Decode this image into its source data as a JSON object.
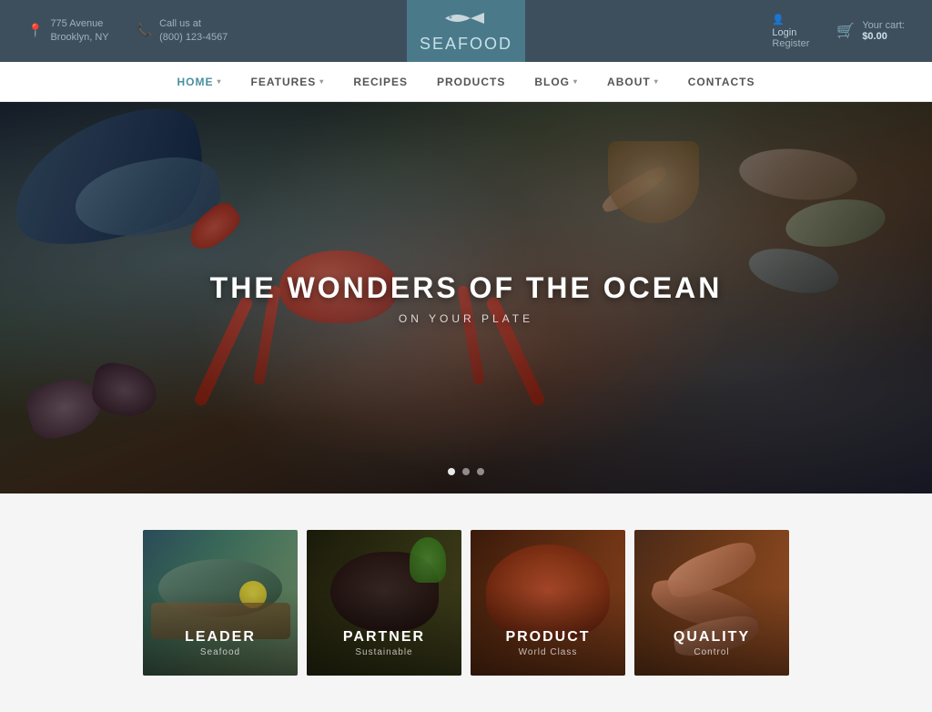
{
  "topbar": {
    "address_line1": "775 Avenue",
    "address_line2": "Brooklyn, NY",
    "phone_label": "Call us at",
    "phone_number": "(800) 123-4567",
    "login_label": "Login",
    "register_label": "Register",
    "cart_label": "Your cart:",
    "cart_price": "$0.00"
  },
  "logo": {
    "text_sea": "SEA",
    "text_food": "FOOD",
    "fish_unicode": "🐟"
  },
  "nav": {
    "items": [
      {
        "label": "HOME",
        "has_arrow": true,
        "active": true
      },
      {
        "label": "FEATURES",
        "has_arrow": true,
        "active": false
      },
      {
        "label": "RECIPES",
        "has_arrow": false,
        "active": false
      },
      {
        "label": "PRODUCTS",
        "has_arrow": false,
        "active": false
      },
      {
        "label": "BLOG",
        "has_arrow": true,
        "active": false
      },
      {
        "label": "ABOUT",
        "has_arrow": true,
        "active": false
      },
      {
        "label": "CONTACTS",
        "has_arrow": false,
        "active": false
      }
    ]
  },
  "hero": {
    "title": "THE WONDERS OF THE OCEAN",
    "subtitle": "ON YOUR PLATE",
    "dots": [
      {
        "active": true
      },
      {
        "active": false
      },
      {
        "active": false
      }
    ]
  },
  "categories": [
    {
      "id": "leader",
      "title": "LEADER",
      "subtitle": "Seafood"
    },
    {
      "id": "partner",
      "title": "PARTNER",
      "subtitle": "Sustainable"
    },
    {
      "id": "product",
      "title": "PRODUCT",
      "subtitle": "World Class"
    },
    {
      "id": "quality",
      "title": "QUALITY",
      "subtitle": "Control"
    }
  ]
}
